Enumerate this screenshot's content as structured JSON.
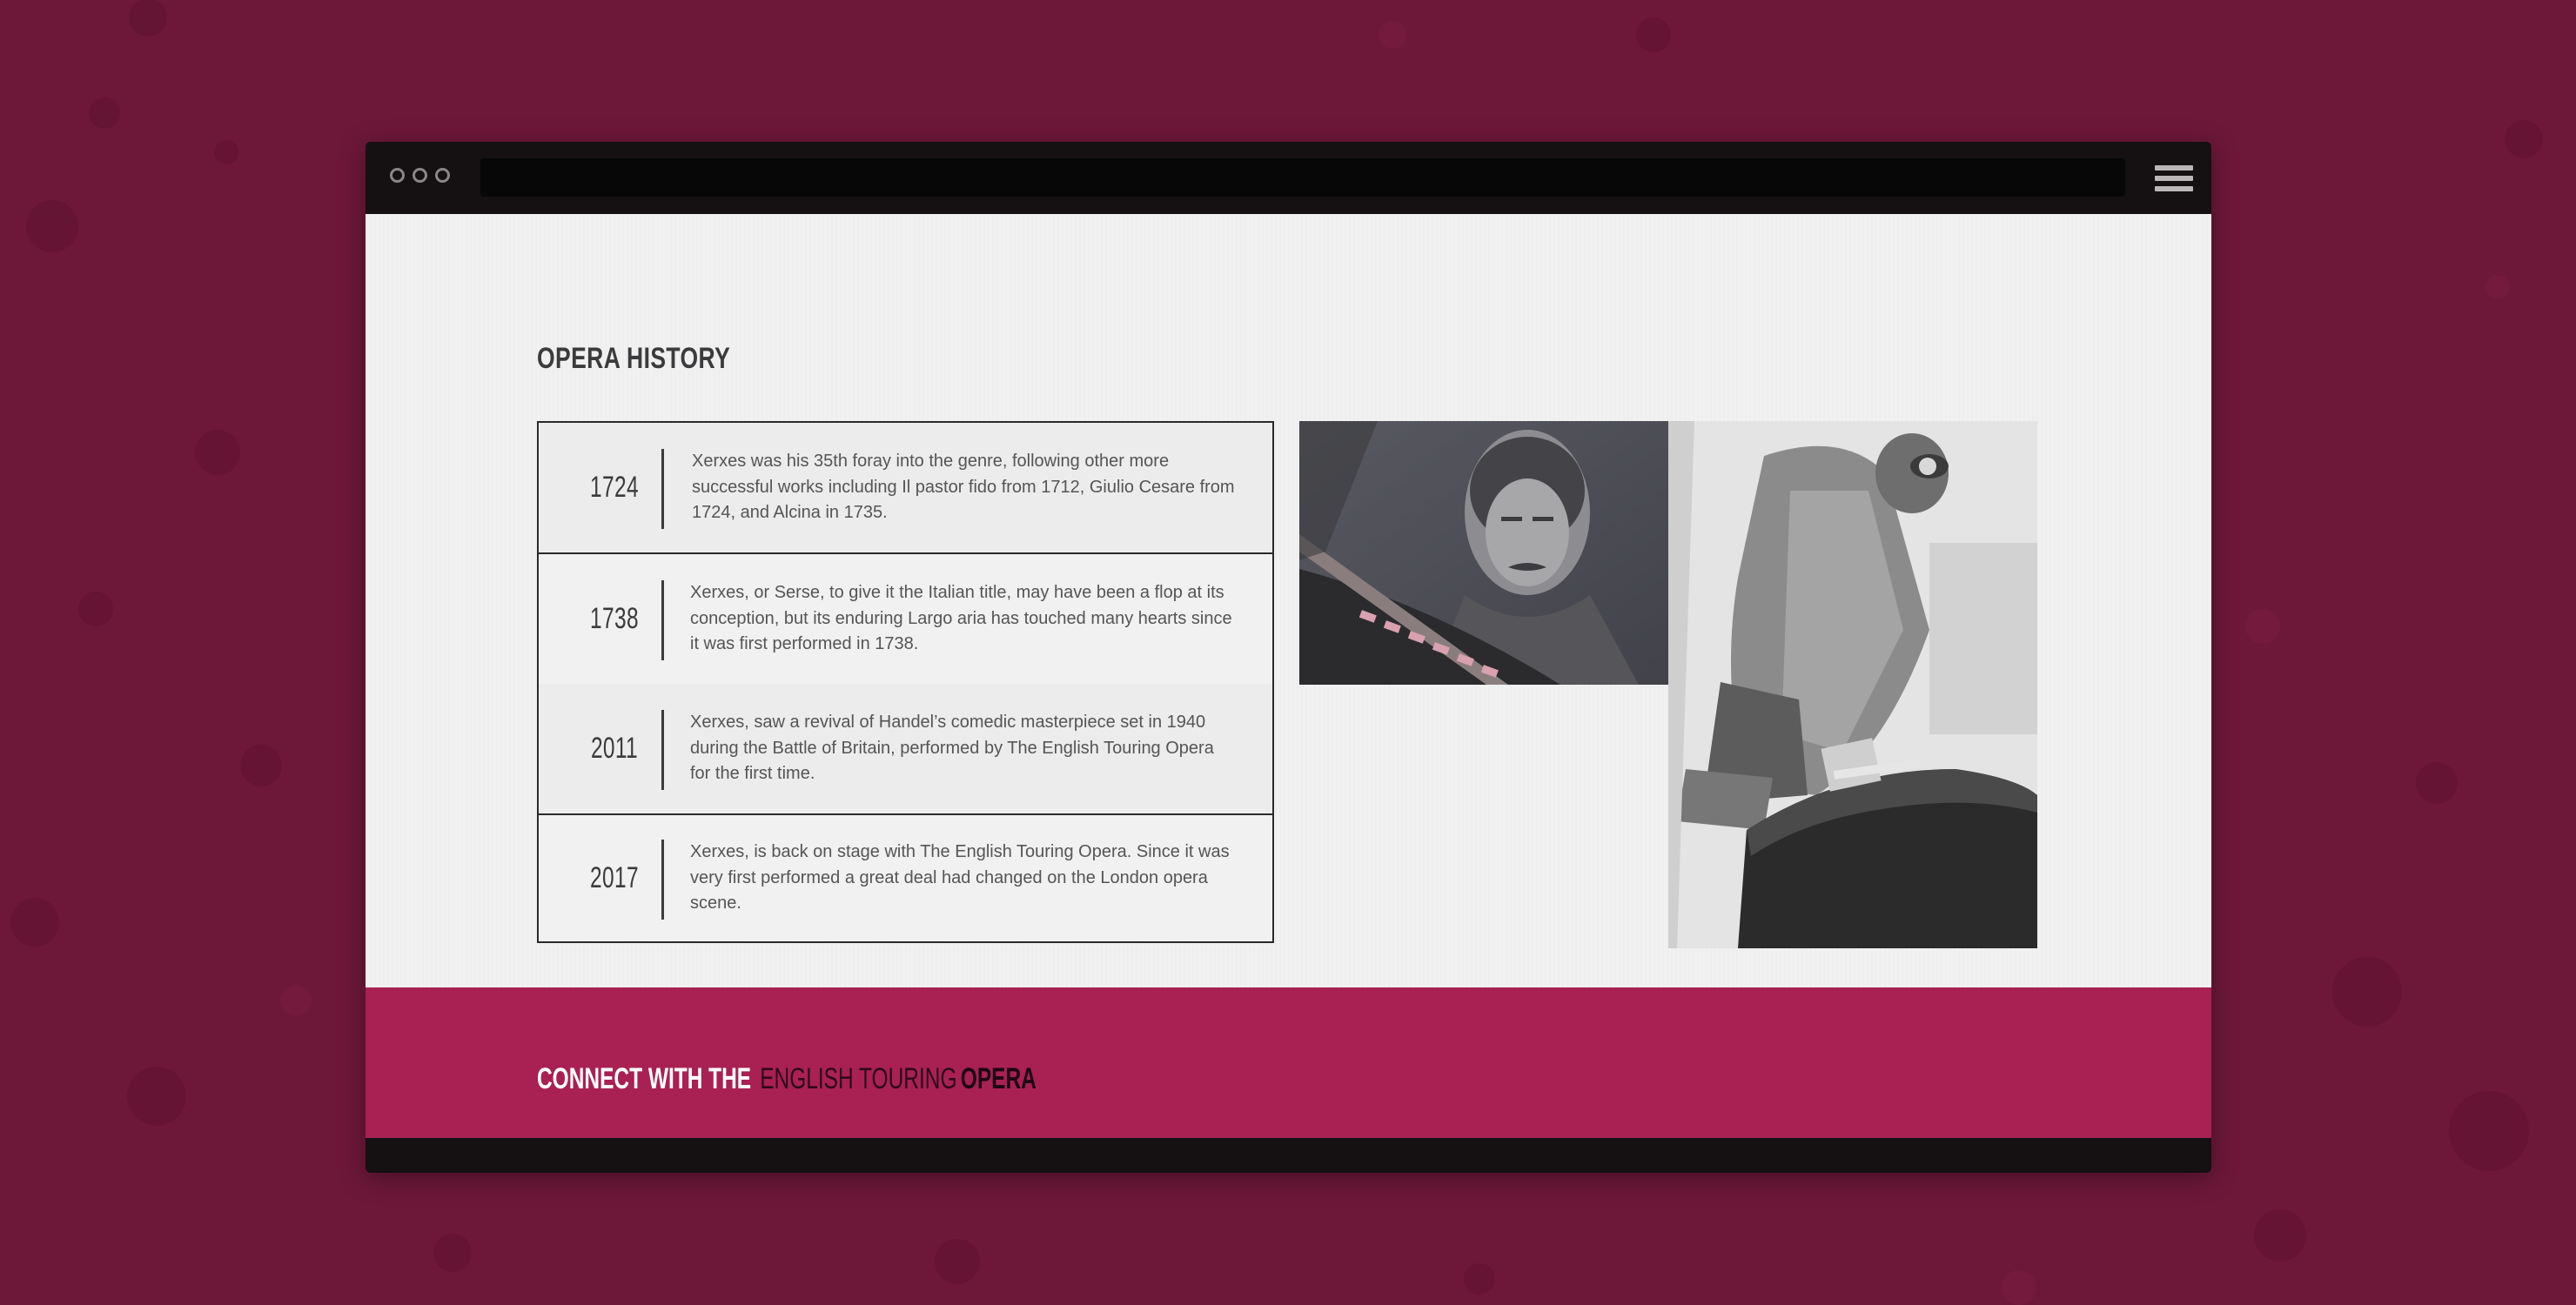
{
  "colors": {
    "page_background": "#6d1839",
    "window_chrome": "#151011",
    "content_background": "#f1f1f1",
    "footer_background": "#a82152",
    "text_dark": "#3b3a3c",
    "text_body": "#555456"
  },
  "browser": {
    "window_controls": [
      "window-dot",
      "window-dot",
      "window-dot"
    ],
    "address_bar": "",
    "menu_icon": "hamburger-menu-icon"
  },
  "page": {
    "section_title": "OPERA HISTORY",
    "timeline": [
      {
        "year": "1724",
        "text": "Xerxes was his 35th foray into the genre, following other more successful works including Il pastor fido from 1712, Giulio Cesare from 1724, and Alcina in 1735."
      },
      {
        "year": "1738",
        "text": "Xerxes, or Serse, to give it the Italian title, may have been a flop at its conception, but its enduring Largo aria has touched many hearts since it was first performed in 1738."
      },
      {
        "year": "2011",
        "text": "Xerxes, saw a revival of Handel’s comedic masterpiece set in 1940 during the Battle of Britain, performed by The English Touring Opera for the first time."
      },
      {
        "year": "2017",
        "text": "Xerxes, is back on stage with The English Touring Opera. Since it was very first performed a great deal had changed on the London opera scene."
      }
    ],
    "photos": {
      "left": "pilot-portrait-photo",
      "right": "pilot-climbing-into-plane-photo"
    }
  },
  "footer": {
    "connect_label": "CONNECT WITH THE",
    "brand_light": "ENGLISH TOURING",
    "brand_bold": "OPERA"
  }
}
